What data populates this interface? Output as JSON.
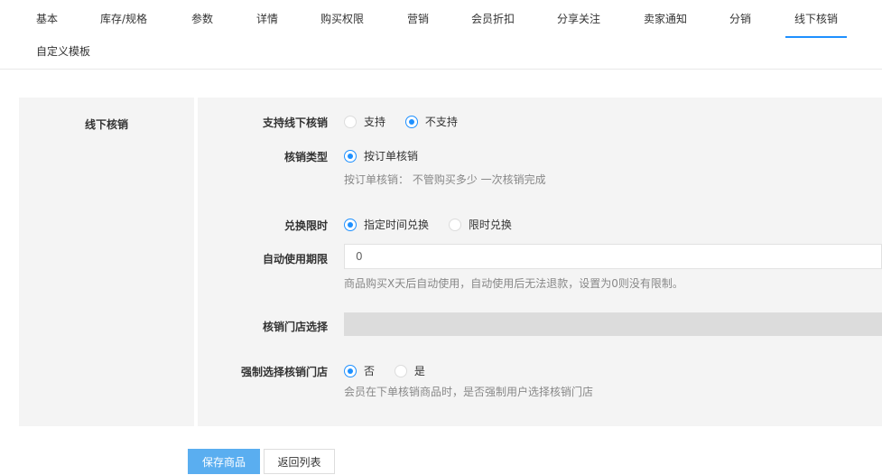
{
  "tabs": [
    {
      "label": "基本"
    },
    {
      "label": "库存/规格"
    },
    {
      "label": "参数"
    },
    {
      "label": "详情"
    },
    {
      "label": "购买权限"
    },
    {
      "label": "营销"
    },
    {
      "label": "会员折扣"
    },
    {
      "label": "分享关注"
    },
    {
      "label": "卖家通知"
    },
    {
      "label": "分销"
    },
    {
      "label": "线下核销"
    },
    {
      "label": "自定义模板"
    }
  ],
  "active_tab": "线下核销",
  "section_title": "线下核销",
  "form": {
    "support": {
      "label": "支持线下核销",
      "options": [
        "支持",
        "不支持"
      ],
      "selected": "不支持"
    },
    "verify_type": {
      "label": "核销类型",
      "options": [
        "按订单核销"
      ],
      "selected": "按订单核销",
      "hint": "按订单核销： 不管购买多少 一次核销完成"
    },
    "exchange_limit": {
      "label": "兑换限时",
      "options": [
        "指定时间兑换",
        "限时兑换"
      ],
      "selected": "指定时间兑换"
    },
    "auto_use": {
      "label": "自动使用期限",
      "value": "0",
      "hint": "商品购买X天后自动使用，自动使用后无法退款，设置为0则没有限制。"
    },
    "store_select": {
      "label": "核销门店选择"
    },
    "force_store": {
      "label": "强制选择核销门店",
      "options": [
        "否",
        "是"
      ],
      "selected": "否",
      "hint": "会员在下单核销商品时，是否强制用户选择核销门店"
    }
  },
  "buttons": {
    "save": "保存商品",
    "back": "返回列表"
  },
  "colors": {
    "accent": "#1e90ff",
    "button": "#5aaef0",
    "panel": "#f4f4f4"
  }
}
